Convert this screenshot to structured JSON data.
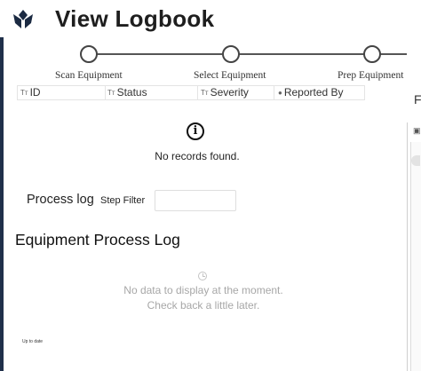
{
  "header": {
    "title": "View Logbook",
    "logo_icon": "tulip-logo-icon"
  },
  "stepper": {
    "steps": [
      {
        "label": "Scan Equipment"
      },
      {
        "label": "Select Equipment"
      },
      {
        "label": "Prep Equipment"
      }
    ]
  },
  "records_table": {
    "columns": [
      {
        "label": "ID",
        "icon": "text-type-icon"
      },
      {
        "label": "Status",
        "icon": "text-type-icon"
      },
      {
        "label": "Severity",
        "icon": "text-type-icon"
      },
      {
        "label": "Reported By",
        "icon": "user-icon"
      }
    ],
    "empty_message": "No records found."
  },
  "process_log": {
    "label": "Process log",
    "filter_label": "Step Filter",
    "filter_value": ""
  },
  "equipment_log": {
    "title": "Equipment Process Log",
    "empty_line1": "No data to display at the moment.",
    "empty_line2": "Check back a little later.",
    "status": "Up to date"
  },
  "side_panel": {
    "letter": "F"
  },
  "colors": {
    "left_bar": "#20304a",
    "header_text": "#1e1e1e",
    "muted_text": "#a7a7a7"
  }
}
